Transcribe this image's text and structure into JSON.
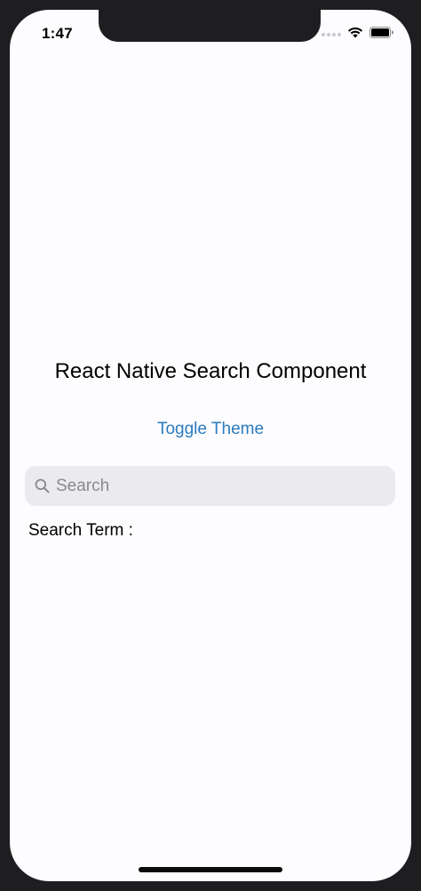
{
  "status_bar": {
    "time": "1:47"
  },
  "app": {
    "title": "React Native Search Component",
    "toggle_label": "Toggle Theme",
    "search": {
      "placeholder": "Search",
      "value": ""
    },
    "search_term_label": "Search Term :",
    "search_term_value": ""
  },
  "icons": {
    "search": "search-icon",
    "wifi": "wifi-icon",
    "battery": "battery-icon",
    "signal": "signal-icon"
  },
  "colors": {
    "link": "#2b7bc0",
    "search_bg": "#ebeaee",
    "placeholder": "#8a898e",
    "screen_bg": "#fdfcfe"
  }
}
